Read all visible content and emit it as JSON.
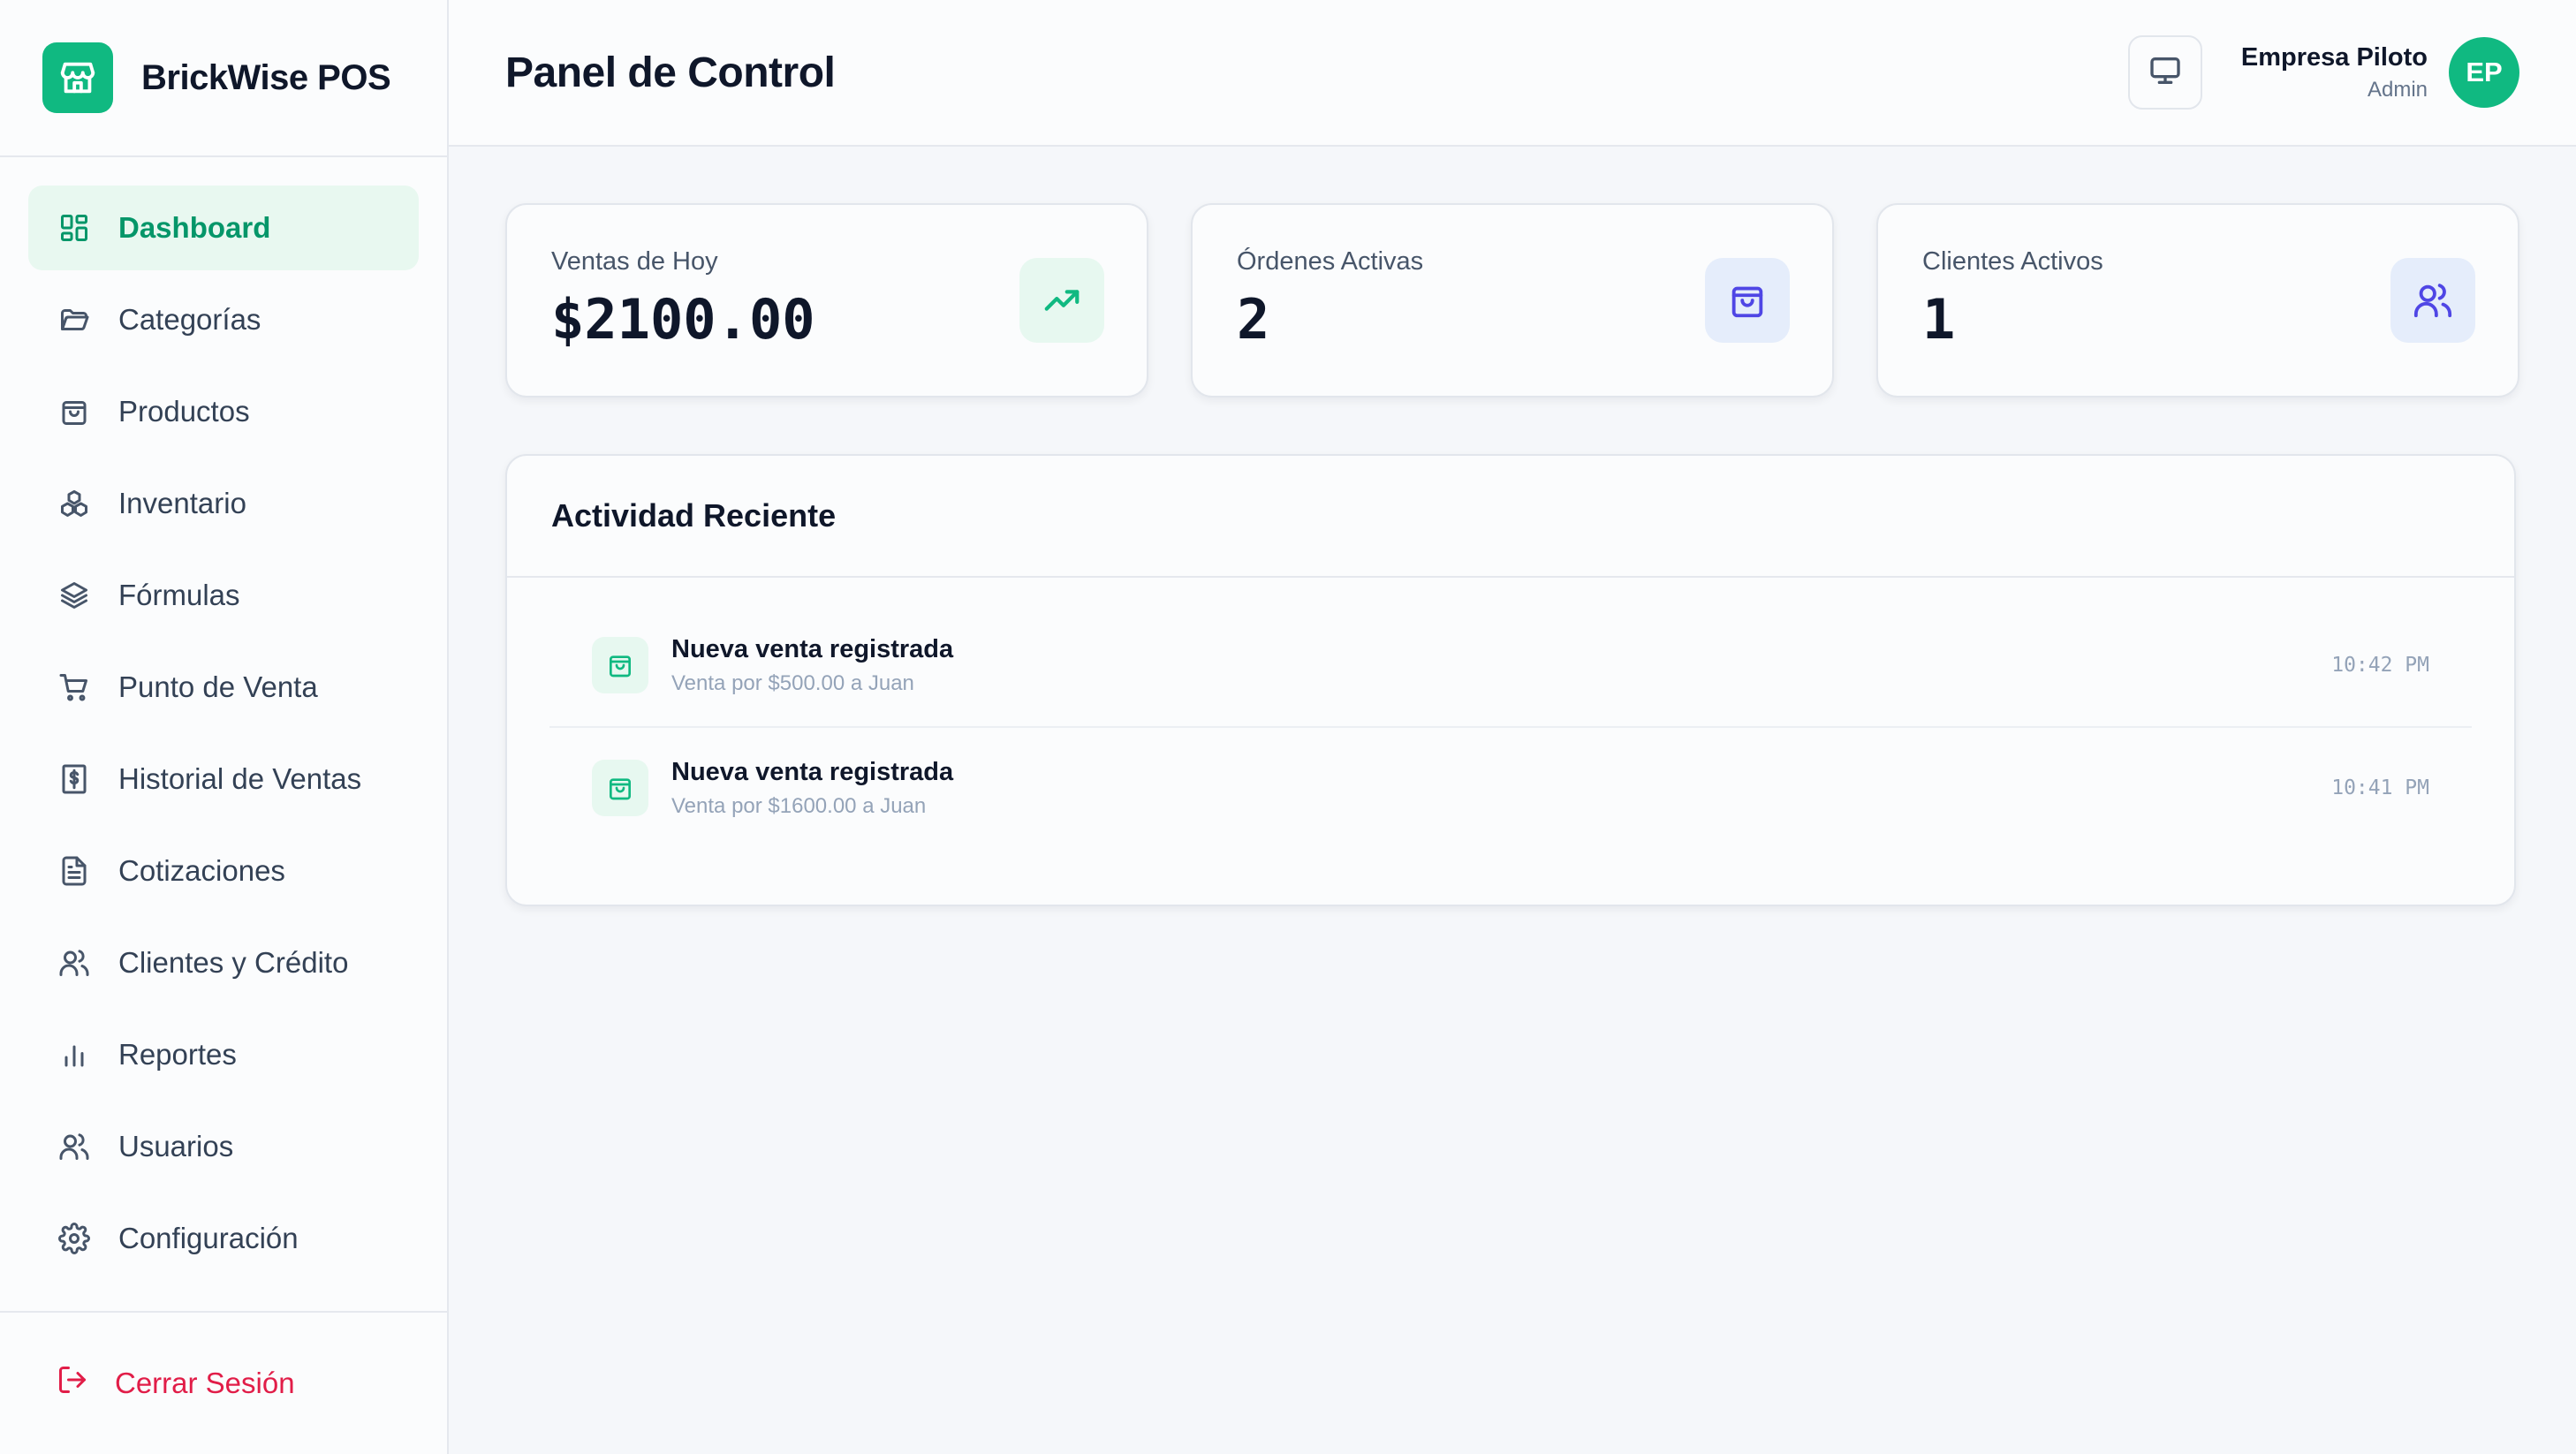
{
  "app": {
    "name": "BrickWise POS",
    "accent": "#10b981",
    "logo_icon": "store-icon"
  },
  "sidebar": {
    "items": [
      {
        "label": "Dashboard",
        "icon": "grid-icon",
        "active": true
      },
      {
        "label": "Categorías",
        "icon": "folder-icon"
      },
      {
        "label": "Productos",
        "icon": "shopping-bag-icon"
      },
      {
        "label": "Inventario",
        "icon": "boxes-icon"
      },
      {
        "label": "Fórmulas",
        "icon": "layers-icon"
      },
      {
        "label": "Punto de Venta",
        "icon": "cart-icon"
      },
      {
        "label": "Historial de Ventas",
        "icon": "receipt-icon"
      },
      {
        "label": "Cotizaciones",
        "icon": "file-text-icon"
      },
      {
        "label": "Clientes y Crédito",
        "icon": "users-icon"
      },
      {
        "label": "Reportes",
        "icon": "bar-chart-icon"
      },
      {
        "label": "Usuarios",
        "icon": "users-icon"
      },
      {
        "label": "Configuración",
        "icon": "gear-icon"
      }
    ],
    "logout_label": "Cerrar Sesión",
    "logout_color": "#e11d48"
  },
  "header": {
    "title": "Panel de Control",
    "user_name": "Empresa Piloto",
    "user_role": "Admin",
    "avatar_initials": "EP"
  },
  "stats": [
    {
      "label": "Ventas de Hoy",
      "value": "$2100.00",
      "icon": "trending-up-icon",
      "color": "#10b981"
    },
    {
      "label": "Órdenes Activas",
      "value": "2",
      "icon": "shopping-bag-icon",
      "color": "#4f46e5"
    },
    {
      "label": "Clientes Activos",
      "value": "1",
      "icon": "users-icon",
      "color": "#4f46e5"
    }
  ],
  "activity": {
    "title": "Actividad Reciente",
    "rows": [
      {
        "title": "Nueva venta registrada",
        "subtitle": "Venta por $500.00 a Juan",
        "time": "10:42 PM"
      },
      {
        "title": "Nueva venta registrada",
        "subtitle": "Venta por $1600.00 a Juan",
        "time": "10:41 PM"
      }
    ]
  }
}
